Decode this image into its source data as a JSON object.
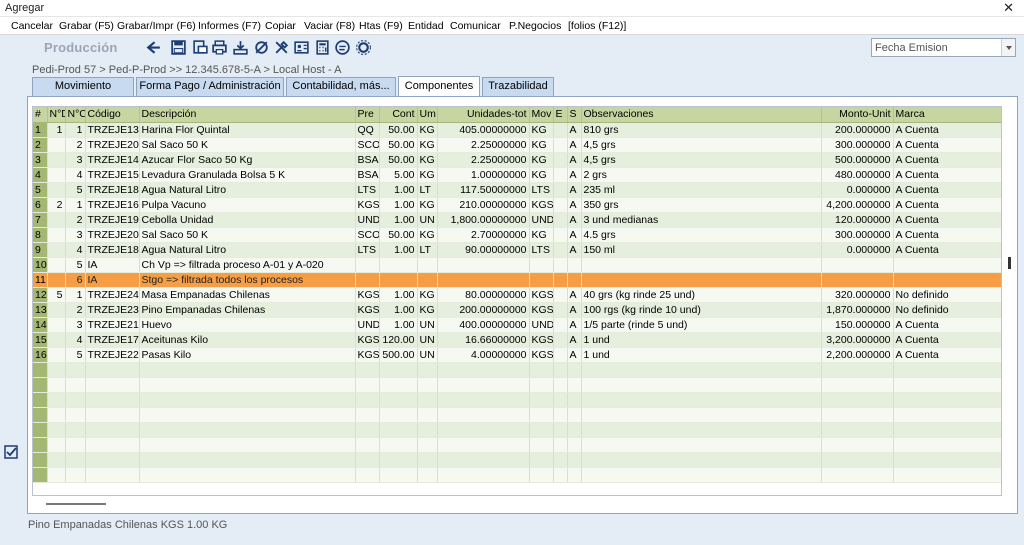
{
  "window": {
    "title": "Agregar",
    "close_glyph": "✕"
  },
  "menu": [
    "Cancelar",
    "Grabar (F5)",
    "Grabar/Impr (F6)",
    "Informes (F7)",
    "Copiar",
    "Vaciar (F8)",
    "Htas (F9)",
    "Entidad",
    "Comunicar",
    "P.Negocios",
    "[folios (F12)]"
  ],
  "toolbar": {
    "module_title": "Producción",
    "icons": [
      "back-arrow-icon",
      "save-icon",
      "print-preview-icon",
      "print-icon",
      "export-icon",
      "clear-icon",
      "tools-icon",
      "card-icon",
      "calculator-icon",
      "chat-icon",
      "settings-icon"
    ],
    "date_combo_value": "Fecha Emision"
  },
  "breadcrumb": "Pedi-Prod 57 > Ped-P-Prod >> 12.345.678-5-A > Local Host - A",
  "tabs": [
    {
      "label": "Movimiento",
      "active": false
    },
    {
      "label": "Forma Pago / Administración",
      "active": false
    },
    {
      "label": "Contabilidad, más...",
      "active": false
    },
    {
      "label": "Componentes",
      "active": true
    },
    {
      "label": "Trazabilidad",
      "active": false
    }
  ],
  "grid": {
    "columns": [
      "#",
      "N°D",
      "N°C",
      "Código",
      "Descripción",
      "Pre",
      "Cont",
      "Um",
      "Unidades-tot",
      "Mov",
      "E",
      "S",
      "Observaciones",
      "Monto-Unit",
      "Marca"
    ],
    "rows": [
      [
        "1",
        "1",
        "1",
        "TRZEJE13",
        "Harina Flor Quintal",
        "QQ",
        "50.00",
        "KG",
        "405.00000000",
        "KG",
        "",
        "A",
        "810 grs",
        "200.000000",
        "A Cuenta"
      ],
      [
        "2",
        "",
        "2",
        "TRZEJE20",
        "Sal Saco 50 K",
        "SCO",
        "50.00",
        "KG",
        "2.25000000",
        "KG",
        "",
        "A",
        "4,5 grs",
        "300.000000",
        "A Cuenta"
      ],
      [
        "3",
        "",
        "3",
        "TRZEJE14",
        "Azucar Flor Saco 50 Kg",
        "BSA",
        "50.00",
        "KG",
        "2.25000000",
        "KG",
        "",
        "A",
        "4,5 grs",
        "500.000000",
        "A Cuenta"
      ],
      [
        "4",
        "",
        "4",
        "TRZEJE15",
        "Levadura Granulada Bolsa 5 K",
        "BSA",
        "5.00",
        "KG",
        "1.00000000",
        "KG",
        "",
        "A",
        "2 grs",
        "480.000000",
        "A Cuenta"
      ],
      [
        "5",
        "",
        "5",
        "TRZEJE18",
        "Agua Natural Litro",
        "LTS",
        "1.00",
        "LT",
        "117.50000000",
        "LTS",
        "",
        "A",
        "235 ml",
        "0.000000",
        "A Cuenta"
      ],
      [
        "6",
        "2",
        "1",
        "TRZEJE16",
        "Pulpa Vacuno",
        "KGS",
        "1.00",
        "KG",
        "210.00000000",
        "KGS",
        "",
        "A",
        "350 grs",
        "4,200.000000",
        "A Cuenta"
      ],
      [
        "7",
        "",
        "2",
        "TRZEJE19",
        "Cebolla Unidad",
        "UND",
        "1.00",
        "UN",
        "1,800.00000000",
        "UND",
        "",
        "A",
        "3 und medianas",
        "120.000000",
        "A Cuenta"
      ],
      [
        "8",
        "",
        "3",
        "TRZEJE20",
        "Sal Saco 50 K",
        "SCO",
        "50.00",
        "KG",
        "2.70000000",
        "KG",
        "",
        "A",
        "4.5 grs",
        "300.000000",
        "A Cuenta"
      ],
      [
        "9",
        "",
        "4",
        "TRZEJE18",
        "Agua Natural Litro",
        "LTS",
        "1.00",
        "LT",
        "90.00000000",
        "LTS",
        "",
        "A",
        "150 ml",
        "0.000000",
        "A Cuenta"
      ],
      [
        "10",
        "",
        "5",
        "IA",
        "Ch Vp => filtrada proceso A-01 y A-020",
        "",
        "",
        "",
        "",
        "",
        "",
        "",
        "",
        "",
        ""
      ],
      [
        "11",
        "",
        "6",
        "IA",
        "Stgo => filtrada todos los procesos",
        "",
        "",
        "",
        "",
        "",
        "",
        "",
        "",
        "",
        ""
      ],
      [
        "12",
        "5",
        "1",
        "TRZEJE24",
        "Masa Empanadas Chilenas",
        "KGS",
        "1.00",
        "KG",
        "80.00000000",
        "KGS",
        "",
        "A",
        "40 grs (kg rinde 25 und)",
        "320.000000",
        "No definido"
      ],
      [
        "13",
        "",
        "2",
        "TRZEJE23",
        "Pino Empanadas Chilenas",
        "KGS",
        "1.00",
        "KG",
        "200.00000000",
        "KGS",
        "",
        "A",
        "100 rgs (kg rinde 10 und)",
        "1,870.000000",
        "No definido"
      ],
      [
        "14",
        "",
        "3",
        "TRZEJE21",
        "Huevo",
        "UND",
        "1.00",
        "UN",
        "400.00000000",
        "UND",
        "",
        "A",
        "1/5 parte (rinde 5 und)",
        "150.000000",
        "A Cuenta"
      ],
      [
        "15",
        "",
        "4",
        "TRZEJE17",
        "Aceitunas Kilo",
        "KGS",
        "120.00",
        "UN",
        "16.66000000",
        "KGS",
        "",
        "A",
        "1 und",
        "3,200.000000",
        "A Cuenta"
      ],
      [
        "16",
        "",
        "5",
        "TRZEJE22",
        "Pasas Kilo",
        "KGS",
        "500.00",
        "UN",
        "4.00000000",
        "KGS",
        "",
        "A",
        "1 und",
        "2,200.000000",
        "A Cuenta"
      ]
    ],
    "selected_row": 11
  },
  "status": "Pino Empanadas Chilenas KGS 1.00 KG"
}
